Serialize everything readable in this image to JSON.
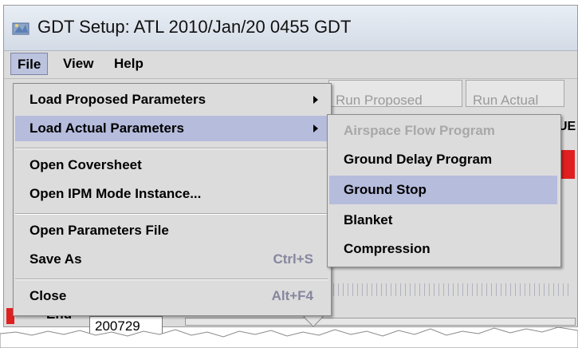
{
  "window": {
    "title": "GDT Setup: ATL 2010/Jan/20 0455 GDT",
    "icon": "gdt-app-icon"
  },
  "menubar": {
    "items": [
      {
        "label": "File",
        "open": true
      },
      {
        "label": "View"
      },
      {
        "label": "Help"
      }
    ]
  },
  "file_menu": {
    "items": [
      {
        "label": "Load Proposed Parameters",
        "submenu": true
      },
      {
        "label": "Load Actual Parameters",
        "submenu": true,
        "highlighted": true
      },
      {
        "label": "Open Coversheet"
      },
      {
        "label": "Open IPM Mode Instance..."
      },
      {
        "label": "Open Parameters File"
      },
      {
        "label": "Save As",
        "shortcut": "Ctrl+S"
      },
      {
        "label": "Close",
        "shortcut": "Alt+F4"
      }
    ]
  },
  "submenu": {
    "items": [
      {
        "label": "Airspace Flow Program",
        "enabled": false
      },
      {
        "label": "Ground Delay Program"
      },
      {
        "label": "Ground Stop",
        "highlighted": true
      },
      {
        "label": "Blanket"
      },
      {
        "label": "Compression"
      }
    ]
  },
  "background": {
    "run_proposed": "Run Proposed",
    "run_actual": "Run Actual",
    "fragment": "UE",
    "end_label": "End",
    "end_value": "200729"
  },
  "colors": {
    "highlight": "#b6bcdc",
    "menu_bg": "#dcdcdc",
    "alert_red": "#e02020"
  }
}
